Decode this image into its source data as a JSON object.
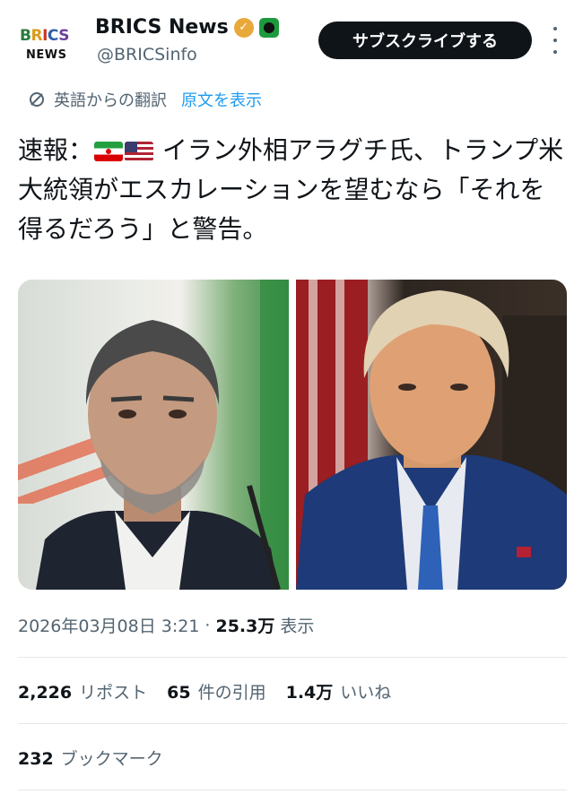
{
  "account": {
    "logo_top": [
      "B",
      "R",
      "I",
      "C",
      "S"
    ],
    "logo_bottom": "NEWS",
    "name": "BRICS News",
    "handle": "@BRICSinfo",
    "verified_badge": "gold-check-icon",
    "affiliate_badge": "affiliate-icon"
  },
  "header": {
    "subscribe_label": "サブスクライブする",
    "more_icon": "more-vertical-icon"
  },
  "translation": {
    "icon": "translate-icon",
    "language_label": "英語からの翻訳",
    "show_original_label": "原文を表示"
  },
  "tweet": {
    "prefix": "速報：",
    "flags": [
      "flag-iran-icon",
      "flag-us-icon"
    ],
    "body": " イラン外相アラグチ氏、トランプ米大統領がエスカレーションを望むなら「それを得るだろう」と警告。"
  },
  "media": {
    "count": 2
  },
  "meta": {
    "timestamp": "2026年03月08日 3:21",
    "separator": "·",
    "views_count": "25.3万",
    "views_label": "表示"
  },
  "stats": {
    "reposts_count": "2,226",
    "reposts_label": "リポスト",
    "quotes_count": "65",
    "quotes_label": "件の引用",
    "likes_count": "1.4万",
    "likes_label": "いいね",
    "bookmarks_count": "232",
    "bookmarks_label": "ブックマーク"
  },
  "colors": {
    "text": "#0f1419",
    "secondary": "#536471",
    "link": "#1d9bf0",
    "button_bg": "#0f1419",
    "divider": "#e4e8eb"
  }
}
